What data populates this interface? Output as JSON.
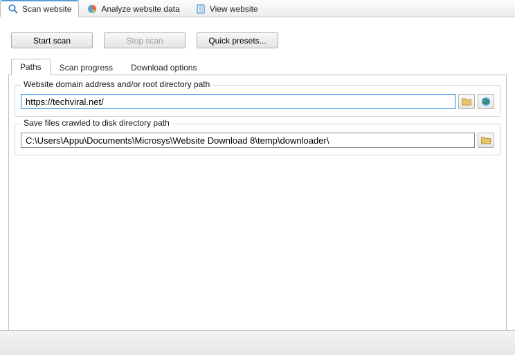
{
  "mainTabs": {
    "scan": "Scan website",
    "analyze": "Analyze website data",
    "view": "View website"
  },
  "buttons": {
    "start": "Start scan",
    "stop": "Stop scan",
    "presets": "Quick presets..."
  },
  "subTabs": {
    "paths": "Paths",
    "progress": "Scan progress",
    "download": "Download options"
  },
  "group1": {
    "label": "Website domain address and/or root directory path",
    "value": "https://techviral.net/"
  },
  "group2": {
    "label": "Save files crawled to disk directory path",
    "value": "C:\\Users\\Appu\\Documents\\Microsys\\Website Download 8\\temp\\downloader\\"
  }
}
